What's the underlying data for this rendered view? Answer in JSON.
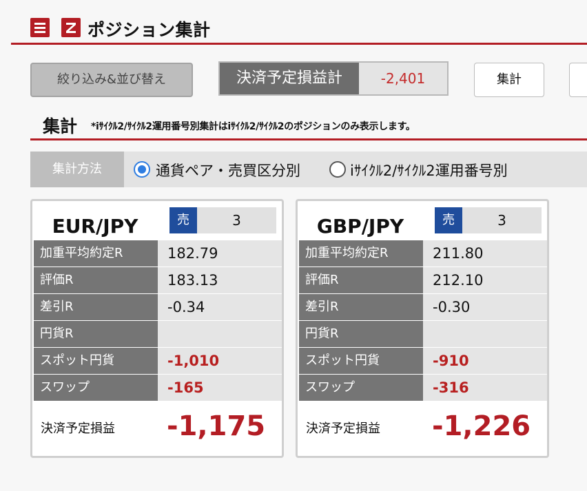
{
  "header": {
    "title": "ポジション集計",
    "menu_icon": "hamburger-menu-icon",
    "logo_icon": "z-logo-icon",
    "accent_color": "#b31d24"
  },
  "toolbar": {
    "filter_button": "絞り込み&並び替え",
    "pl_label": "決済予定損益計",
    "pl_value": "-2,401",
    "aggregate_button": "集計"
  },
  "section": {
    "title": "集計",
    "note": "*iｻｲｸﾙ2/ｻｲｸﾙ2運用番号別集計はiｻｲｸﾙ2/ｻｲｸﾙ2のポジションのみ表示します。"
  },
  "method": {
    "label": "集計方法",
    "options": [
      {
        "label": "通貨ペア・売買区分別",
        "selected": true
      },
      {
        "label": "iｻｲｸﾙ2/ｻｲｸﾙ2運用番号別",
        "selected": false
      }
    ]
  },
  "cards": [
    {
      "pair": "EUR/JPY",
      "side": "売",
      "qty": "3",
      "rows": [
        {
          "label": "加重平均約定R",
          "value": "182.79",
          "negative": false
        },
        {
          "label": "評価R",
          "value": "183.13",
          "negative": false
        },
        {
          "label": "差引R",
          "value": "-0.34",
          "negative": false
        },
        {
          "label": "円貨R",
          "value": "",
          "negative": false
        },
        {
          "label": "スポット円貨",
          "value": "-1,010",
          "negative": true
        },
        {
          "label": "スワップ",
          "value": "-165",
          "negative": true
        }
      ],
      "total_label": "決済予定損益",
      "total_value": "-1,175"
    },
    {
      "pair": "GBP/JPY",
      "side": "売",
      "qty": "3",
      "rows": [
        {
          "label": "加重平均約定R",
          "value": "211.80",
          "negative": false
        },
        {
          "label": "評価R",
          "value": "212.10",
          "negative": false
        },
        {
          "label": "差引R",
          "value": "-0.30",
          "negative": false
        },
        {
          "label": "円貨R",
          "value": "",
          "negative": false
        },
        {
          "label": "スポット円貨",
          "value": "-910",
          "negative": true
        },
        {
          "label": "スワップ",
          "value": "-316",
          "negative": true
        }
      ],
      "total_label": "決済予定損益",
      "total_value": "-1,226"
    }
  ]
}
